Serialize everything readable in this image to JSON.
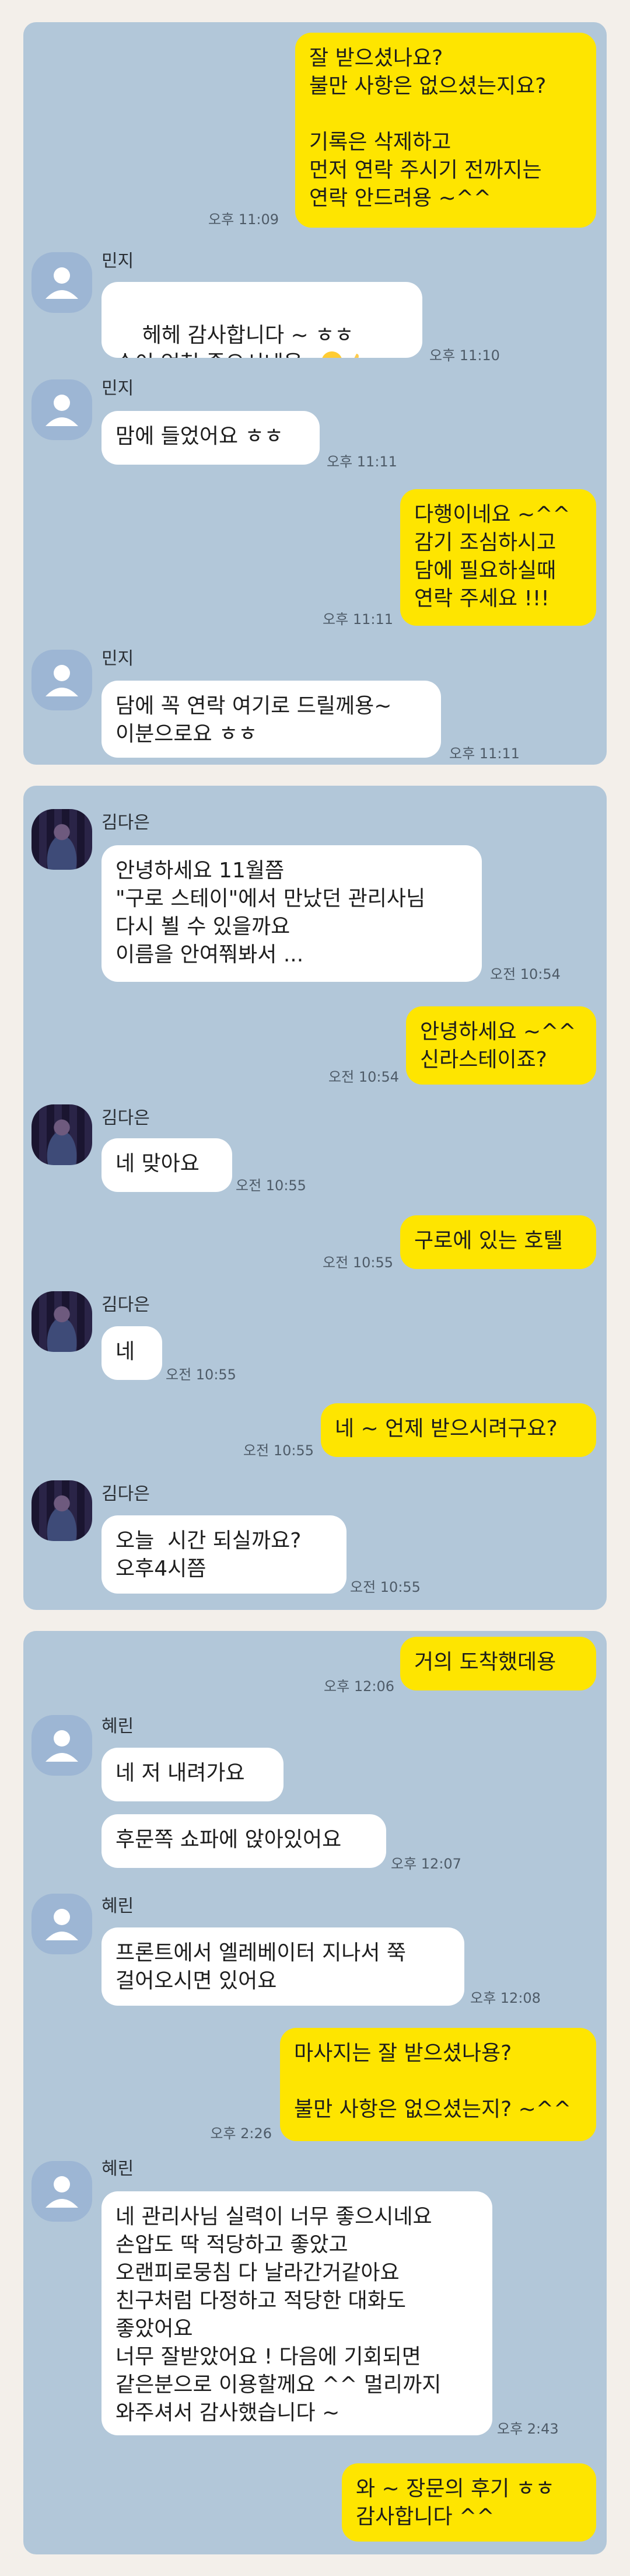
{
  "panels": [
    {
      "messages": [
        {
          "dir": "out",
          "text": "잘 받으셨나요?\n불만 사항은 없으셨는지요?\n\n기록은 삭제하고\n먼저 연락 주시기 전까지는\n연락 안드려용 ~^^",
          "time": "오후 11:09"
        },
        {
          "dir": "in",
          "sender": "민지",
          "text": "헤헤 감사합니다 ~ ㅎㅎ\n손이 엄청 좋으시네용~",
          "time": "오후 11:10"
        },
        {
          "dir": "in",
          "sender": "민지",
          "text": "맘에 들었어요 ㅎㅎ",
          "time": "오후 11:11"
        },
        {
          "dir": "out",
          "text": "다행이네요 ~^^\n감기 조심하시고\n담에 필요하실때\n연락 주세요 !!!",
          "time": "오후 11:11"
        },
        {
          "dir": "in",
          "sender": "민지",
          "text": "담에 꼭 연락 여기로 드릴께용~\n이분으로요 ㅎㅎ",
          "time": "오후 11:11"
        }
      ]
    },
    {
      "messages": [
        {
          "dir": "in",
          "sender": "김다은",
          "text": "안녕하세요 11월쯤\n\"구로 스테이\"에서 만났던 관리사님\n다시 뵐 수 있을까요\n이름을 안여쭤봐서 ...",
          "time": "오전 10:54"
        },
        {
          "dir": "out",
          "text": "안녕하세요 ~^^\n신라스테이죠?",
          "time": "오전 10:54"
        },
        {
          "dir": "in",
          "sender": "김다은",
          "text": "네 맞아요",
          "time": "오전 10:55"
        },
        {
          "dir": "out",
          "text": "구로에 있는 호텔",
          "time": "오전 10:55"
        },
        {
          "dir": "in",
          "sender": "김다은",
          "text": "네",
          "time": "오전 10:55"
        },
        {
          "dir": "out",
          "text": "네 ~ 언제 받으시려구요?",
          "time": "오전 10:55"
        },
        {
          "dir": "in",
          "sender": "김다은",
          "text": "오늘  시간 되실까요?\n오후4시쯤",
          "time": "오전 10:55"
        }
      ]
    },
    {
      "messages": [
        {
          "dir": "out",
          "text": "거의 도착했데용",
          "time": "오후 12:06"
        },
        {
          "dir": "in",
          "sender": "혜린",
          "text": "네 저 내려가요",
          "time": ""
        },
        {
          "dir": "in",
          "sender": "",
          "text": "후문쪽 쇼파에 앉아있어요",
          "time": "오후 12:07"
        },
        {
          "dir": "in",
          "sender": "혜린",
          "text": "프론트에서 엘레베이터 지나서 쭉\n걸어오시면 있어요",
          "time": "오후 12:08"
        },
        {
          "dir": "out",
          "text": "마사지는 잘 받으셨나용?\n\n불만 사항은 없으셨는지? ~^^",
          "time": "오후 2:26"
        },
        {
          "dir": "in",
          "sender": "혜린",
          "text": "네 관리사님 실력이 너무 좋으시네요\n손압도 딱 적당하고 좋았고\n오랜피로뭉침 다 날라간거같아요\n친구처럼 다정하고 적당한 대화도\n좋았어요\n너무 잘받았어요 ! 다음에 기회되면\n같은분으로 이용할께요 ^^ 멀리까지\n와주셔서 감사했습니다 ~",
          "time": "오후 2:43"
        },
        {
          "dir": "out",
          "text": "와 ~ 장문의 후기 ㅎㅎ\n감사합니다 ^^",
          "time": ""
        }
      ]
    }
  ],
  "icons": {
    "default_avatar": "person-silhouette-icon",
    "photo_avatar": "blurred-profile-photo",
    "emoji_1": "winking-tongue-emoji",
    "emoji_2": "thumbs-up-emoji"
  },
  "colors": {
    "chat_bg": "#b2c7d9",
    "outgoing_bubble": "#fee500",
    "incoming_bubble": "#ffffff",
    "page_bg": "#f3efea"
  }
}
